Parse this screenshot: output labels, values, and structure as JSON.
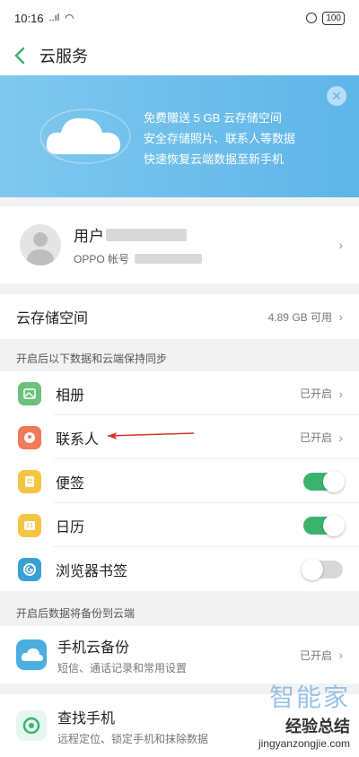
{
  "status": {
    "time": "10:16",
    "signal": "..ıl",
    "battery": "100"
  },
  "nav": {
    "title": "云服务"
  },
  "banner": {
    "lines": [
      "免费赠送 5 GB 云存储空间",
      "安全存储照片、联系人等数据",
      "快速恢复云端数据至新手机"
    ],
    "close": "✕"
  },
  "account": {
    "name_prefix": "用户",
    "id_label": "OPPO 帐号"
  },
  "storage": {
    "label": "云存储空间",
    "value": "4.89 GB 可用"
  },
  "sync": {
    "header": "开启后以下数据和云端保持同步",
    "items": [
      {
        "label": "相册",
        "status": "已开启",
        "icon": "photo-icon",
        "color": "#6cc17e"
      },
      {
        "label": "联系人",
        "status": "已开启",
        "icon": "contacts-icon",
        "color": "#f07a5a"
      },
      {
        "label": "便签",
        "toggle": true,
        "icon": "note-icon",
        "color": "#f5c542"
      },
      {
        "label": "日历",
        "toggle": true,
        "icon": "calendar-icon",
        "color": "#f5c542"
      },
      {
        "label": "浏览器书签",
        "toggle": false,
        "icon": "browser-icon",
        "color": "#3aa0d8"
      }
    ]
  },
  "backup": {
    "header": "开启后数据将备份到云端",
    "title": "手机云备份",
    "subtitle": "短信、通话记录和常用设置",
    "status": "已开启"
  },
  "find": {
    "title": "查找手机",
    "subtitle": "远程定位、锁定手机和抹除数据"
  },
  "watermark": {
    "line1": "智能家",
    "line2a": "经验总结",
    "line2b": "jingyanzongjie.com"
  },
  "colors": {
    "accent": "#3bb36f",
    "banner": "#6bbde9"
  }
}
